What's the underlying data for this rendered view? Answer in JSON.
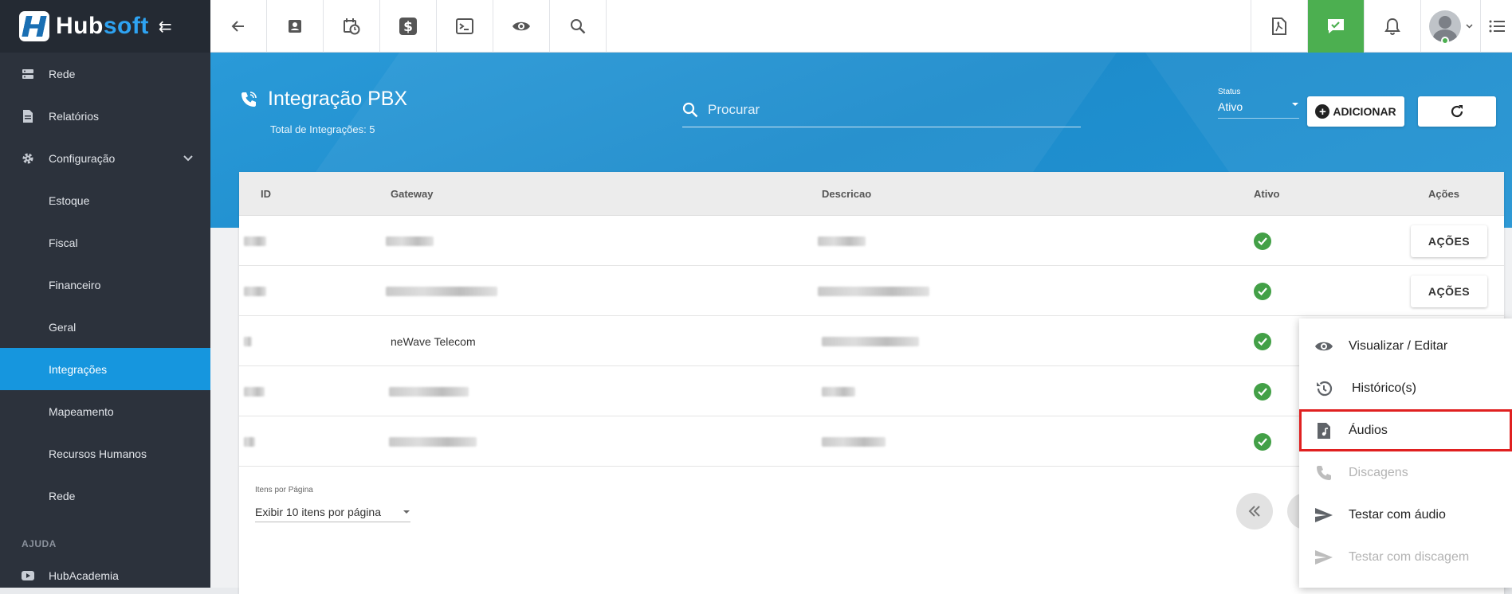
{
  "brand": {
    "name_main": "Hub",
    "name_accent": "soft",
    "collapse_icon": "menu-collapse-icon"
  },
  "sidebar": {
    "items": [
      {
        "label": "Rede",
        "icon": "server-icon"
      },
      {
        "label": "Relatórios",
        "icon": "document-icon"
      },
      {
        "label": "Configuração",
        "icon": "gear-icon"
      },
      {
        "label": "Estoque"
      },
      {
        "label": "Fiscal"
      },
      {
        "label": "Financeiro"
      },
      {
        "label": "Geral"
      },
      {
        "label": "Integrações",
        "active": true
      },
      {
        "label": "Mapeamento"
      },
      {
        "label": "Recursos Humanos"
      },
      {
        "label": "Rede"
      }
    ],
    "section_help": "AJUDA",
    "help_item": {
      "label": "HubAcademia",
      "icon": "youtube-icon"
    }
  },
  "topbar": {
    "left_icons": [
      "arrow-back-icon",
      "contact-card-icon",
      "calendar-clock-icon",
      "dollar-icon",
      "terminal-icon",
      "eye-icon",
      "search-icon"
    ],
    "right_icons": [
      "pdf-icon",
      "chat-check-icon",
      "bell-icon",
      "avatar",
      "list-icon"
    ]
  },
  "header": {
    "title": "Integração PBX",
    "subtitle": "Total de Integrações: 5",
    "search_placeholder": "Procurar",
    "status_label": "Status",
    "status_value": "Ativo",
    "add_label": "ADICIONAR"
  },
  "table": {
    "columns": {
      "id": "ID",
      "gateway": "Gateway",
      "descricao": "Descricao",
      "ativo": "Ativo",
      "acoes": "Ações"
    },
    "rows": [
      {
        "gateway": "",
        "actions_label": "AÇÕES",
        "active": true
      },
      {
        "gateway": "",
        "actions_label": "AÇÕES",
        "active": true
      },
      {
        "gateway": "neWave Telecom",
        "active": true
      },
      {
        "gateway": "",
        "active": true
      },
      {
        "gateway": "",
        "active": true
      }
    ]
  },
  "pagination": {
    "label": "Itens por Página",
    "value": "Exibir 10 itens por página"
  },
  "action_menu": {
    "items": [
      {
        "label": "Visualizar / Editar",
        "icon": "eye-icon",
        "disabled": false
      },
      {
        "label": "Histórico(s)",
        "icon": "history-icon",
        "disabled": false
      },
      {
        "label": "Áudios",
        "icon": "audio-file-icon",
        "disabled": false,
        "highlighted": true
      },
      {
        "label": "Discagens",
        "icon": "phone-icon",
        "disabled": true
      },
      {
        "label": "Testar com áudio",
        "icon": "send-icon",
        "disabled": false
      },
      {
        "label": "Testar com discagem",
        "icon": "send-icon",
        "disabled": true
      }
    ]
  },
  "colors": {
    "sidebar_bg": "#2c323c",
    "active_item": "#1696de",
    "banner": "#2394d3",
    "success": "#43a047",
    "highlight": "#e02020"
  }
}
